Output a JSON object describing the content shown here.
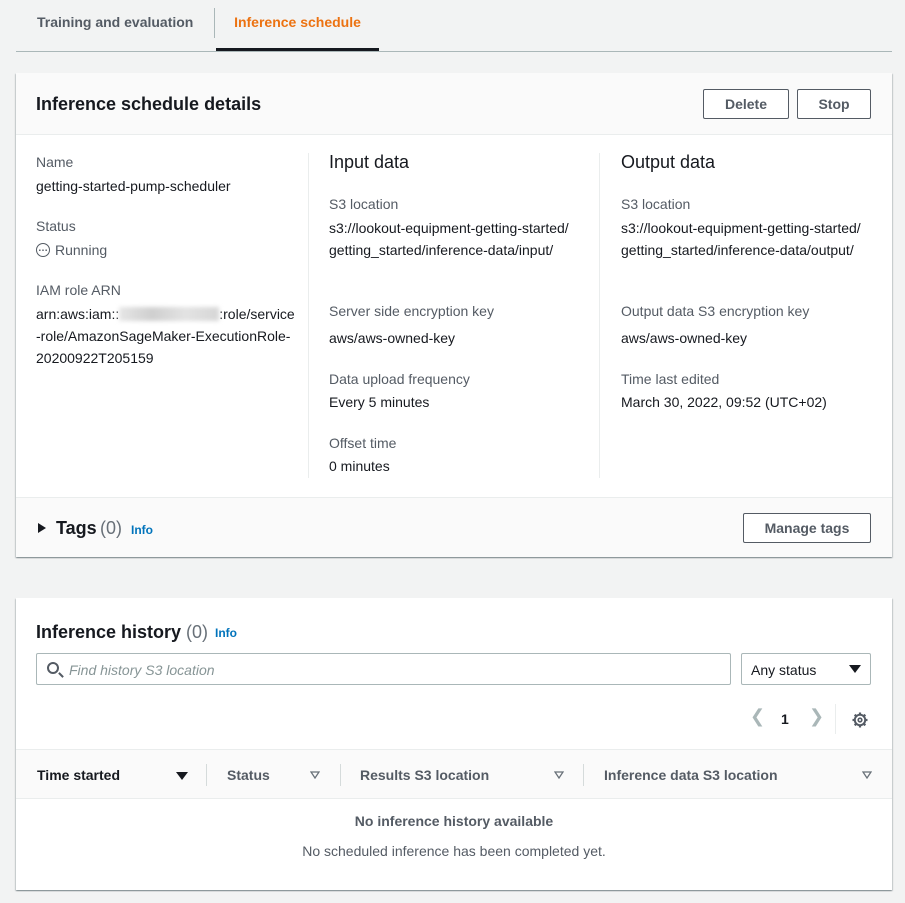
{
  "tabs": [
    {
      "label": "Training and evaluation"
    },
    {
      "label": "Inference schedule"
    }
  ],
  "details": {
    "title": "Inference schedule details",
    "delete_label": "Delete",
    "stop_label": "Stop",
    "name_label": "Name",
    "name_value": "getting-started-pump-scheduler",
    "status_label": "Status",
    "status_value": "Running",
    "iam_label": "IAM role ARN",
    "iam_prefix": "arn:aws:iam::",
    "iam_suffix": ":role/service-role/AmazonSageMaker-ExecutionRole-20200922T205159",
    "input": {
      "heading": "Input data",
      "s3_label": "S3 location",
      "s3_value": "s3://lookout-equipment-getting-started/getting_started/inference-data/input/",
      "enc_label": "Server side encryption key",
      "enc_value": "aws/aws-owned-key",
      "freq_label": "Data upload frequency",
      "freq_value": "Every 5 minutes",
      "offset_label": "Offset time",
      "offset_value": "0 minutes"
    },
    "output": {
      "heading": "Output data",
      "s3_label": "S3 location",
      "s3_value": "s3://lookout-equipment-getting-started/getting_started/inference-data/output/",
      "enc_label": "Output data S3 encryption key",
      "enc_value": "aws/aws-owned-key",
      "edited_label": "Time last edited",
      "edited_value": "March 30, 2022, 09:52 (UTC+02)"
    },
    "tags": {
      "title": "Tags",
      "count": "(0)",
      "info": "Info",
      "manage_label": "Manage tags"
    }
  },
  "history": {
    "title": "Inference history",
    "count": "(0)",
    "info": "Info",
    "search_placeholder": "Find history S3 location",
    "status_filter": "Any status",
    "page": "1",
    "columns": [
      "Time started",
      "Status",
      "Results S3 location",
      "Inference data S3 location"
    ],
    "empty_title": "No inference history available",
    "empty_sub": "No scheduled inference has been completed yet."
  },
  "colors": {
    "accent": "#ec7211",
    "link": "#0073bb",
    "text": "#16191f",
    "muted": "#545b64"
  }
}
